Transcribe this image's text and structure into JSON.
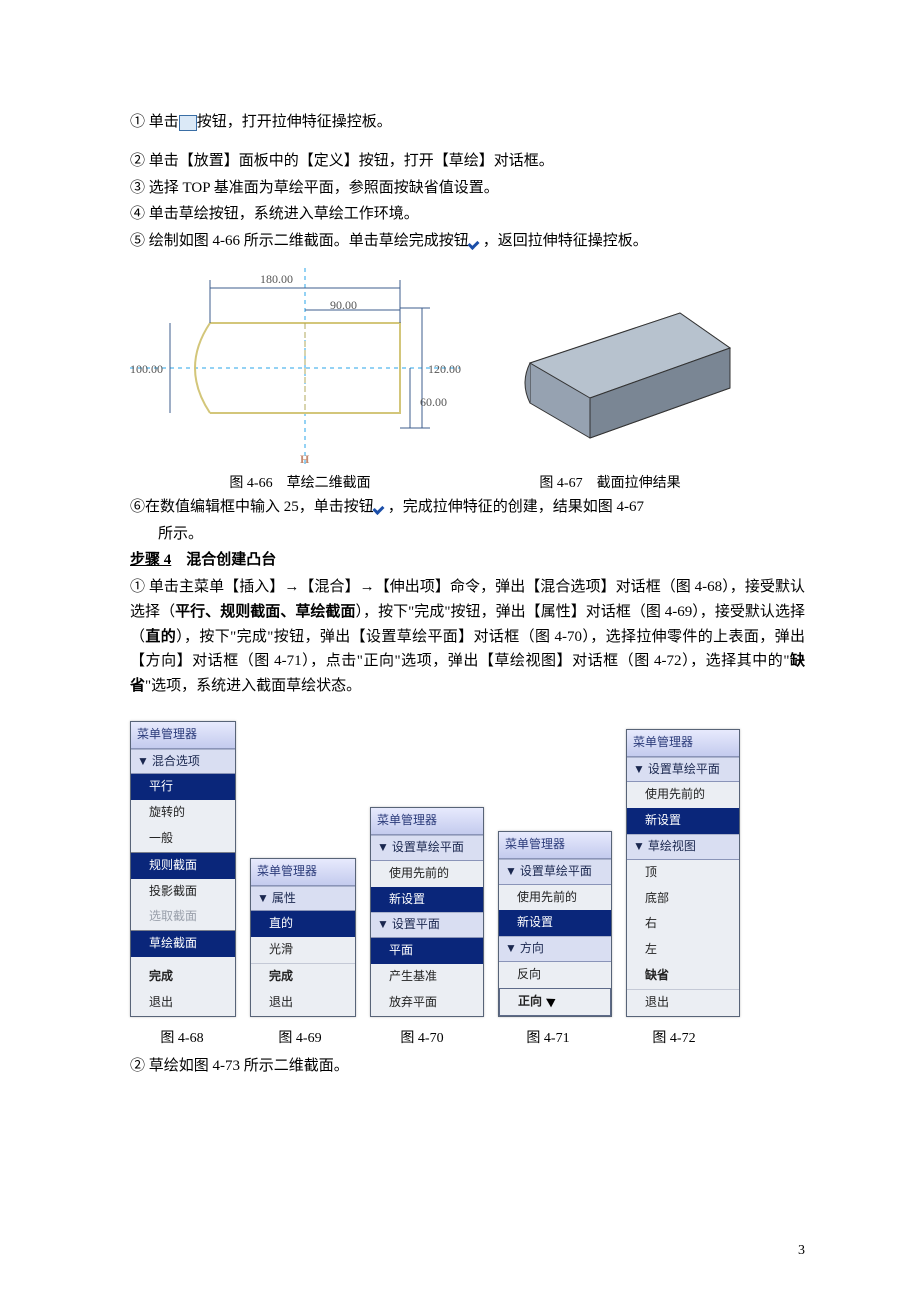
{
  "lines": {
    "l1a": "① 单击",
    "l1b": "按钮，打开拉伸特征操控板。",
    "l2": "② 单击【放置】面板中的【定义】按钮，打开【草绘】对话框。",
    "l3": "③ 选择 TOP 基准面为草绘平面，参照面按缺省值设置。",
    "l4": "④ 单击草绘按钮，系统进入草绘工作环境。",
    "l5a": "⑤ 绘制如图 4-66 所示二维截面。单击草绘完成按钮",
    "l5b": "，返回拉伸特征操控板。",
    "l6a": "⑥在数值编辑框中输入 25，单击按钮",
    "l6b": "，完成拉伸特征的创建，结果如图 4-67",
    "l6c": "所示。"
  },
  "figcap": {
    "f466": "图 4-66　草绘二维截面",
    "f467": "图 4-67　截面拉伸结果",
    "f468": "图 4-68",
    "f469": "图 4-69",
    "f470": "图 4-70",
    "f471": "图 4-71",
    "f472": "图 4-72"
  },
  "sketch": {
    "d180": "180.00",
    "d90": "90.00",
    "d100": "100.00",
    "d120": "120.00",
    "d60": "60.00",
    "axisH": "H"
  },
  "step4": {
    "title_a": "步骤 4",
    "title_b": "　混合创建凸台",
    "p1a": "① 单击主菜单【插入】→【混合】→【伸出项】命令，弹出【混合选项】对话框（图 4-68），接受默认选择（",
    "p1b": "平行、规则截面、草绘截面",
    "p1c": "），按下\"完成\"按钮，弹出【属性】对话框（图 4-69），接受默认选择（",
    "p1d": "直的",
    "p1e": "），按下\"完成\"按钮，弹出【设置草绘平面】对话框（图 4-70），选择拉伸零件的上表面，弹出【方向】对话框（图 4-71），点击\"正向\"选项，弹出【草绘视图】对话框（图 4-72），选择其中的\"",
    "p1f": "缺省",
    "p1g": "\"选项，系统进入截面草绘状态。",
    "p2": "② 草绘如图 4-73 所示二维截面。"
  },
  "menus": {
    "m68": {
      "title": "菜单管理器",
      "sec1": "混合选项",
      "i1": "平行",
      "i2": "旋转的",
      "i3": "一般",
      "i4": "规则截面",
      "i5": "投影截面",
      "i6": "选取截面",
      "i7": "草绘截面",
      "done": "完成",
      "exit": "退出"
    },
    "m69": {
      "title": "菜单管理器",
      "sec1": "属性",
      "i1": "直的",
      "i2": "光滑",
      "done": "完成",
      "exit": "退出"
    },
    "m70": {
      "title": "菜单管理器",
      "sec1": "设置草绘平面",
      "i1": "使用先前的",
      "i2": "新设置",
      "sec2": "设置平面",
      "i3": "平面",
      "i4": "产生基准",
      "i5": "放弃平面"
    },
    "m71": {
      "title": "菜单管理器",
      "sec1": "设置草绘平面",
      "i1": "使用先前的",
      "i2": "新设置",
      "sec2": "方向",
      "i3": "反向",
      "i4": "正向"
    },
    "m72": {
      "title": "菜单管理器",
      "sec1": "设置草绘平面",
      "i1": "使用先前的",
      "i2": "新设置",
      "sec2": "草绘视图",
      "i3": "顶",
      "i4": "底部",
      "i5": "右",
      "i6": "左",
      "i7": "缺省",
      "exit": "退出"
    }
  },
  "page": "3"
}
